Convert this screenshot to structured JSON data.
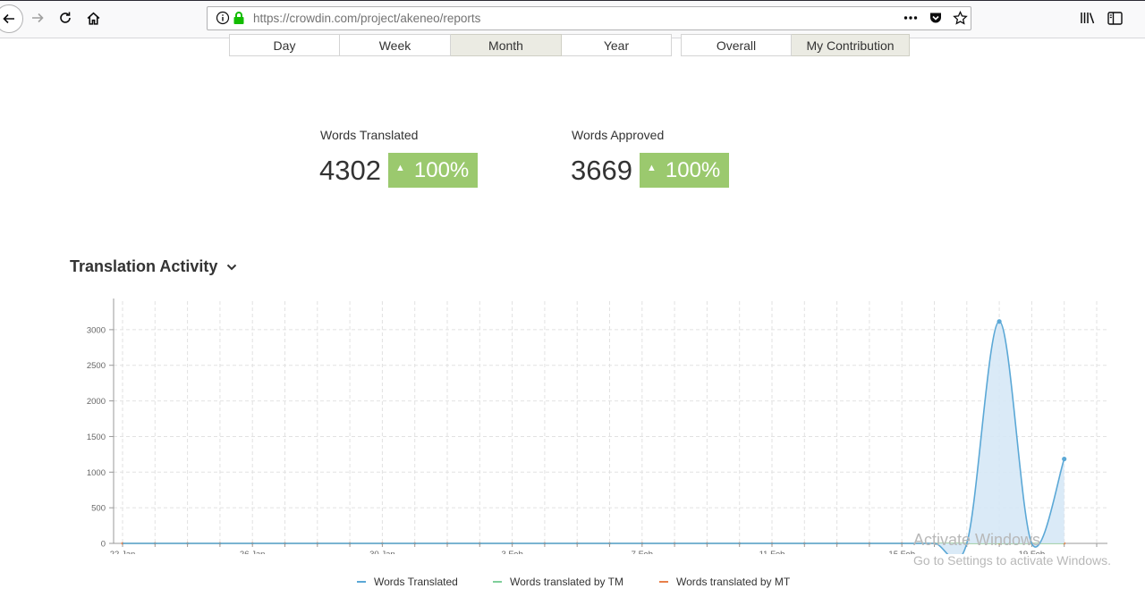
{
  "browser": {
    "url_host": "https://crowdin.com",
    "url_path": "/project/akeneo/reports"
  },
  "period_tabs": [
    {
      "label": "Day",
      "active": false
    },
    {
      "label": "Week",
      "active": false
    },
    {
      "label": "Month",
      "active": true
    },
    {
      "label": "Year",
      "active": false
    }
  ],
  "scope_tabs": [
    {
      "label": "Overall",
      "active": false
    },
    {
      "label": "My Contribution",
      "active": true
    }
  ],
  "stats": {
    "translated": {
      "label": "Words Translated",
      "value": "4302",
      "change": "100%"
    },
    "approved": {
      "label": "Words Approved",
      "value": "3669",
      "change": "100%"
    }
  },
  "section_title": "Translation Activity",
  "colors": {
    "accent_green": "#9bc96e",
    "series_translated": "#5ba8d6",
    "series_tm": "#7fcf9a",
    "series_mt": "#e8804a"
  },
  "chart_data": {
    "type": "area",
    "title": "",
    "xlabel": "",
    "ylabel": "",
    "ylim": [
      0,
      3400
    ],
    "y_ticks": [
      0,
      500,
      1000,
      1500,
      2000,
      2500,
      3000
    ],
    "x_tick_labels": [
      "22 Jan",
      "26 Jan",
      "30 Jan",
      "3 Feb",
      "7 Feb",
      "11 Feb",
      "15 Feb",
      "19 Feb"
    ],
    "x_tick_every": 4,
    "grid": true,
    "legend_position": "bottom",
    "x": [
      "22 Jan",
      "23 Jan",
      "24 Jan",
      "25 Jan",
      "26 Jan",
      "27 Jan",
      "28 Jan",
      "29 Jan",
      "30 Jan",
      "31 Jan",
      "1 Feb",
      "2 Feb",
      "3 Feb",
      "4 Feb",
      "5 Feb",
      "6 Feb",
      "7 Feb",
      "8 Feb",
      "9 Feb",
      "10 Feb",
      "11 Feb",
      "12 Feb",
      "13 Feb",
      "14 Feb",
      "15 Feb",
      "16 Feb",
      "17 Feb",
      "18 Feb",
      "19 Feb",
      "20 Feb",
      "21 Feb"
    ],
    "series": [
      {
        "name": "Words Translated",
        "values": [
          0,
          0,
          0,
          0,
          0,
          0,
          0,
          0,
          0,
          0,
          0,
          0,
          0,
          0,
          0,
          0,
          0,
          0,
          0,
          0,
          0,
          0,
          0,
          0,
          0,
          0,
          0,
          3115,
          0,
          1185,
          0
        ]
      },
      {
        "name": "Words translated by TM",
        "values": [
          0,
          0,
          0,
          0,
          0,
          0,
          0,
          0,
          0,
          0,
          0,
          0,
          0,
          0,
          0,
          0,
          0,
          0,
          0,
          0,
          0,
          0,
          0,
          0,
          0,
          0,
          0,
          0,
          0,
          0,
          0
        ]
      },
      {
        "name": "Words translated by MT",
        "values": [
          0,
          0,
          0,
          0,
          0,
          0,
          0,
          0,
          0,
          0,
          0,
          0,
          0,
          0,
          0,
          0,
          0,
          0,
          0,
          0,
          0,
          0,
          0,
          0,
          0,
          0,
          0,
          0,
          0,
          0,
          0
        ]
      }
    ]
  },
  "watermark": {
    "line1": "Activate Windows",
    "line2": "Go to Settings to activate Windows."
  }
}
